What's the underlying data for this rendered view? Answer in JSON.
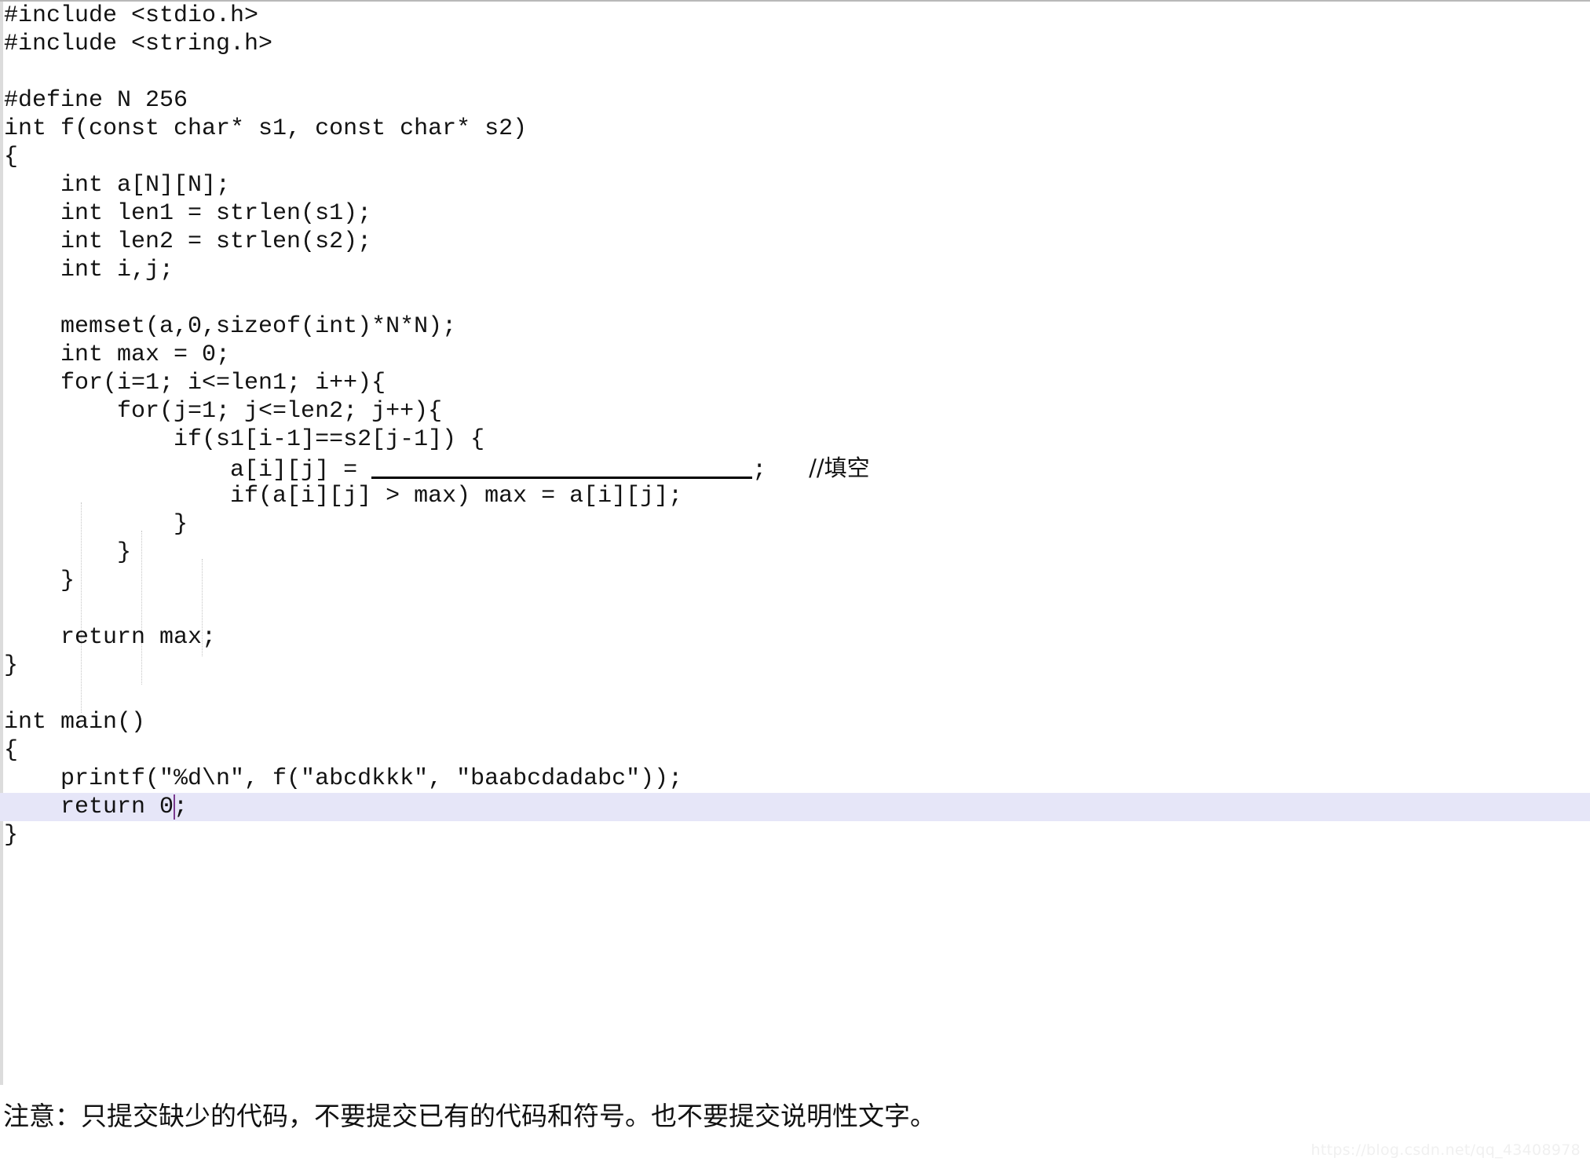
{
  "editor": {
    "language": "c",
    "highlight_color": "#e6e6f8",
    "caret_color": "#7a3b8f",
    "guide_color": "#c4c4c4",
    "text_color": "#131313",
    "background_color": "#ffffff",
    "lines": [
      "#include <stdio.h>",
      "#include <string.h>",
      "",
      "#define N 256",
      "int f(const char* s1, const char* s2)",
      "{",
      "    int a[N][N];",
      "    int len1 = strlen(s1);",
      "    int len2 = strlen(s2);",
      "    int i,j;",
      "",
      "    memset(a,0,sizeof(int)*N*N);",
      "    int max = 0;",
      "    for(i=1; i<=len1; i++){",
      "        for(j=1; j<=len2; j++){",
      "            if(s1[i-1]==s2[j-1]) {",
      "                a[i][j] = ",
      "                if(a[i][j] > max) max = a[i][j];",
      "            }",
      "        }",
      "    }",
      "",
      "    return max;",
      "}",
      "",
      "int main()",
      "{",
      "    printf(\"%d\\n\", f(\"abcdkkk\", \"baabcdadabc\"));",
      "    return 0;",
      "}"
    ],
    "blank_line": {
      "prefix": "                a[i][j] = ",
      "suffix": ";   ",
      "comment": "//填空"
    },
    "highlighted_line_index": 27,
    "highlighted_line_text": "    return 0;",
    "caret_after_text": "    return 0"
  },
  "note": {
    "text": "注意：只提交缺少的代码，不要提交已有的代码和符号。也不要提交说明性文字。"
  },
  "watermark": {
    "text": "https://blog.csdn.net/qq_43408978"
  }
}
